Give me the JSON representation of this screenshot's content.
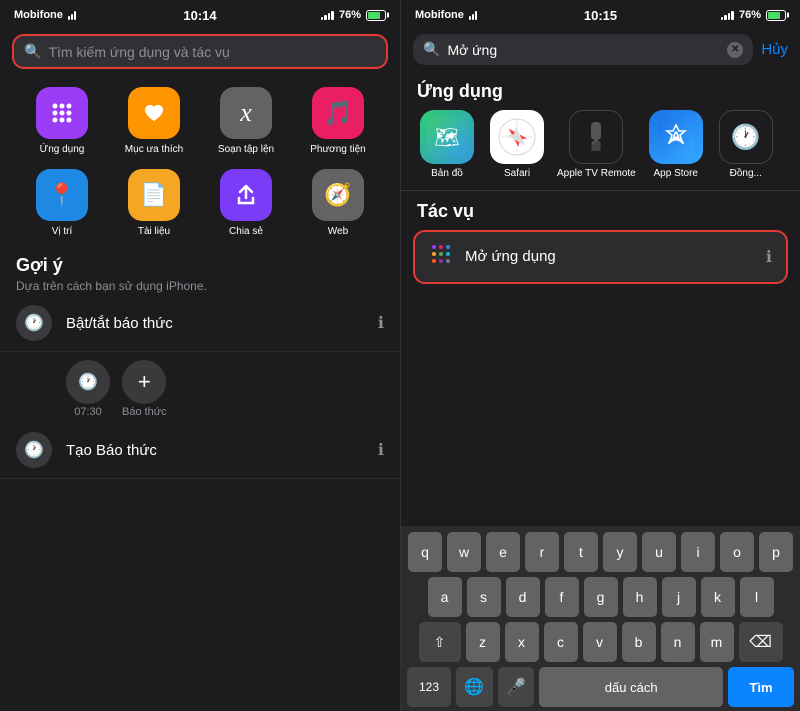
{
  "screen1": {
    "statusBar": {
      "carrier": "Mobifone",
      "time": "10:14",
      "battery": "76%"
    },
    "searchBar": {
      "placeholder": "Tìm kiếm ứng dụng và tác vụ"
    },
    "iconRows": [
      [
        {
          "id": "ung-dung",
          "label": "Ứng dụng",
          "emoji": "⠿",
          "colorClass": "ic-ung-dung"
        },
        {
          "id": "muc-ua-thich",
          "label": "Mục ưa thích",
          "emoji": "♥",
          "colorClass": "ic-muc-ua-thich"
        },
        {
          "id": "soan-tap-len",
          "label": "Soạn tập lện",
          "emoji": "𝑥",
          "colorClass": "ic-soan-tap-len"
        },
        {
          "id": "phuong-tien",
          "label": "Phương tiện",
          "emoji": "♪",
          "colorClass": "ic-phuong-tien"
        }
      ],
      [
        {
          "id": "vi-tri",
          "label": "Vị trí",
          "emoji": "↗",
          "colorClass": "ic-vi-tri"
        },
        {
          "id": "tai-lieu",
          "label": "Tài liệu",
          "emoji": "📄",
          "colorClass": "ic-tai-lieu"
        },
        {
          "id": "chia-se",
          "label": "Chia sẻ",
          "emoji": "↑",
          "colorClass": "ic-chia-se"
        },
        {
          "id": "web",
          "label": "Web",
          "emoji": "🧭",
          "colorClass": "ic-web"
        }
      ]
    ],
    "goiY": {
      "title": "Gợi ý",
      "subtitle": "Dựa trên cách bạn sử dụng iPhone."
    },
    "listItems": [
      {
        "id": "bat-tat-bao-thuc",
        "icon": "🕐",
        "label": "Bật/tắt báo thức"
      },
      {
        "id": "tao-bao-thuc",
        "icon": "🕐",
        "label": "Tạo Báo thức"
      }
    ],
    "alarmItems": [
      {
        "time": "07:30",
        "label": "07:30"
      },
      {
        "icon": "+",
        "label": "Báo thức"
      }
    ]
  },
  "screen2": {
    "statusBar": {
      "carrier": "Mobifone",
      "time": "10:15",
      "battery": "76%"
    },
    "searchBar": {
      "typedText": "Mở ứng",
      "cancelLabel": "Hủy"
    },
    "ungDungSection": {
      "title": "Ứng dụng",
      "apps": [
        {
          "id": "ban-do",
          "label": "Bản đồ",
          "colorClass": "ic-maps",
          "emoji": "🗺"
        },
        {
          "id": "safari",
          "label": "Safari",
          "colorClass": "ic-safari",
          "emoji": "🧭"
        },
        {
          "id": "apple-tv",
          "label": "Apple TV Remote",
          "colorClass": "ic-appletv",
          "emoji": "📺"
        },
        {
          "id": "app-store",
          "label": "App Store",
          "colorClass": "ic-appstore",
          "emoji": "🅐"
        },
        {
          "id": "dong-ho",
          "label": "Đồng...",
          "colorClass": "ic-clock",
          "emoji": "🕐"
        }
      ]
    },
    "tacVuSection": {
      "title": "Tác vụ",
      "item": {
        "icon": "⠿",
        "label": "Mở ứng dụng"
      }
    },
    "keyboard": {
      "rows": [
        [
          "q",
          "w",
          "e",
          "r",
          "t",
          "y",
          "u",
          "i",
          "o",
          "p"
        ],
        [
          "a",
          "s",
          "d",
          "f",
          "g",
          "h",
          "j",
          "k",
          "l"
        ],
        [
          "z",
          "x",
          "c",
          "v",
          "b",
          "n",
          "m"
        ],
        [
          "123",
          "globe",
          "mic",
          "dấu cách",
          "Tìm"
        ]
      ]
    }
  }
}
